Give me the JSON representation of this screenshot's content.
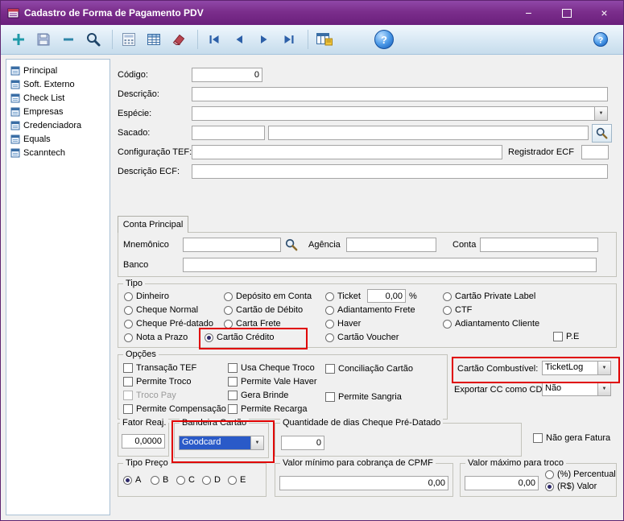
{
  "window": {
    "title": "Cadastro de Forma de Pagamento PDV",
    "minimize_glyph": "−",
    "close_glyph": "×"
  },
  "toolbar": {
    "help_glyph": "?",
    "buttons": [
      "add",
      "save",
      "delete",
      "search",
      "calculator",
      "table",
      "eraser",
      "nav-first",
      "nav-previous",
      "nav-next",
      "nav-last",
      "report",
      "help",
      "help-right"
    ]
  },
  "icons": {
    "combo_arrow": "▼"
  },
  "sidebar": {
    "items": [
      "Principal",
      "Soft. Externo",
      "Check List",
      "Empresas",
      "Credenciadora",
      "Equals",
      "Scanntech"
    ]
  },
  "form": {
    "codigo_label": "Código:",
    "codigo_value": "0",
    "descricao_label": "Descrição:",
    "descricao_value": "",
    "especie_label": "Espécie:",
    "especie_value": "",
    "sacado_label": "Sacado:",
    "sacado_value1": "",
    "sacado_value2": "",
    "config_tef_label": "Configuração TEF:",
    "config_tef_value": "",
    "registrador_ecf_label": "Registrador ECF",
    "registrador_ecf_value": "",
    "descricao_ecf_label": "Descrição ECF:",
    "descricao_ecf_value": "",
    "tab_conta": "Conta Principal",
    "conta": {
      "mnemonico_label": "Mnemônico",
      "mnemonico_value": "",
      "agencia_label": "Agência",
      "agencia_value": "",
      "conta_label": "Conta",
      "conta_value": "",
      "banco_label": "Banco",
      "banco_value": ""
    },
    "tipo": {
      "legend": "Tipo",
      "options": [
        "Dinheiro",
        "Cheque Normal",
        "Cheque Pré-datado",
        "Nota a Prazo",
        "Depósito em Conta",
        "Cartão de Débito",
        "Carta Frete",
        "Cartão Crédito",
        "Ticket",
        "Adiantamento Frete",
        "Haver",
        "Cartão Voucher",
        "Cartão Private Label",
        "CTF",
        "Adiantamento Cliente"
      ],
      "selected": "Cartão Crédito",
      "ticket_value": "0,00",
      "ticket_percent": "%",
      "pe_label": "P.E"
    },
    "opcoes": {
      "legend": "Opções",
      "items": [
        "Transação TEF",
        "Permite Troco",
        "Troco Pay",
        "Permite Compensação",
        "Usa Cheque Troco",
        "Permite Vale Haver",
        "Gera Brinde",
        "Permite Recarga",
        "Conciliação Cartão",
        "Permite Sangria"
      ],
      "disabled_item": "Troco Pay"
    },
    "cartao_combustivel_label": "Cartão Combustível:",
    "cartao_combustivel_value": "TicketLog",
    "exportar_cc_label": "Exportar CC como CD:",
    "exportar_cc_value": "Não",
    "fator_reaj": {
      "legend": "Fator Reaj.",
      "value": "0,0000"
    },
    "bandeira_cartao": {
      "legend": "Bandeira Cartão",
      "value": "Goodcard"
    },
    "qtd_dias": {
      "legend": "Quantidade de dias Cheque Pré-Datado",
      "value": "0"
    },
    "nao_gera_fatura_label": "Não gera Fatura",
    "tipo_preco": {
      "legend": "Tipo Preço",
      "options": [
        "A",
        "B",
        "C",
        "D",
        "E"
      ],
      "selected": "A"
    },
    "cpmf": {
      "legend": "Valor mínimo para cobrança de CPMF",
      "value": "0,00"
    },
    "troco_max": {
      "legend": "Valor máximo para troco",
      "value": "0,00",
      "radio_percentual": "(%) Percentual",
      "radio_valor": "(R$) Valor",
      "selected": "(R$) Valor"
    }
  },
  "highlights": {
    "color": "#E00000"
  }
}
